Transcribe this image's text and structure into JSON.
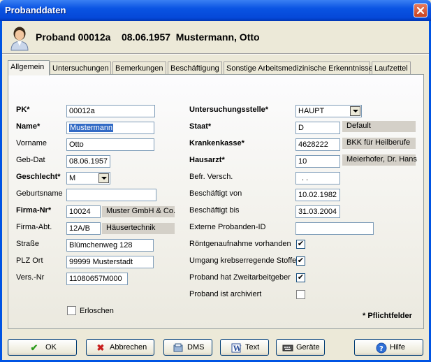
{
  "window": {
    "title": "Probanddaten"
  },
  "header": {
    "title": "Proband 00012a    08.06.1957  Mustermann, Otto"
  },
  "tabs": [
    "Allgemein",
    "Untersuchungen",
    "Bemerkungen",
    "Beschäftigung",
    "Sonstige Arbeitsmedizinische Erkenntnisse",
    "Laufzettel"
  ],
  "left": {
    "pk": {
      "label": "PK*",
      "value": "00012a"
    },
    "name": {
      "label": "Name*",
      "value": "Mustermann"
    },
    "vorname": {
      "label": "Vorname",
      "value": "Otto"
    },
    "gebdat": {
      "label": "Geb-Dat",
      "value": "08.06.1957"
    },
    "geschlecht": {
      "label": "Geschlecht*",
      "value": "M"
    },
    "geburtsname": {
      "label": "Geburtsname",
      "value": ""
    },
    "firmanr": {
      "label": "Firma-Nr*",
      "value": "10024",
      "desc": "Muster GmbH & Co."
    },
    "firmaabt": {
      "label": "Firma-Abt.",
      "value": "12A/B",
      "desc": "Häusertechnik"
    },
    "strasse": {
      "label": "Straße",
      "value": "Blümchenweg 128"
    },
    "plzort": {
      "label": "PLZ Ort",
      "value": "99999 Musterstadt"
    },
    "versnr": {
      "label": "Vers.-Nr",
      "value": "11080657M000"
    },
    "erloschen": {
      "label": "Erloschen",
      "checked": false
    }
  },
  "right": {
    "ustelle": {
      "label": "Untersuchungsstelle*",
      "value": "HAUPT"
    },
    "staat": {
      "label": "Staat*",
      "value": "D",
      "desc": "Default"
    },
    "kk": {
      "label": "Krankenkasse*",
      "value": "4628222",
      "desc": "BKK für Heilberufe"
    },
    "hausarzt": {
      "label": "Hausarzt*",
      "value": "10",
      "desc": "Meierhofer, Dr. Hans"
    },
    "befr": {
      "label": "Befr. Versch.",
      "value": ". ."
    },
    "bvon": {
      "label": "Beschäftigt von",
      "value": "10.02.1982"
    },
    "bbis": {
      "label": "Beschäftigt bis",
      "value": "31.03.2004"
    },
    "extid": {
      "label": "Externe Probanden-ID",
      "value": ""
    },
    "roentgen": {
      "label": "Röntgenaufnahme vorhanden",
      "checked": true
    },
    "krebs": {
      "label": "Umgang krebserregende Stoffe",
      "checked": true
    },
    "zweit": {
      "label": "Proband hat Zweitarbeitgeber",
      "checked": true
    },
    "archiv": {
      "label": "Proband ist archiviert",
      "checked": false
    }
  },
  "pflicht": "* Pflichtfelder",
  "buttons": {
    "ok": "OK",
    "abbrechen": "Abbrechen",
    "dms": "DMS",
    "text": "Text",
    "geraete": "Geräte",
    "hilfe": "Hilfe"
  },
  "colors": {
    "titlebar": "#0054e3",
    "dialog": "#ece9d8",
    "close": "#c8421f"
  }
}
